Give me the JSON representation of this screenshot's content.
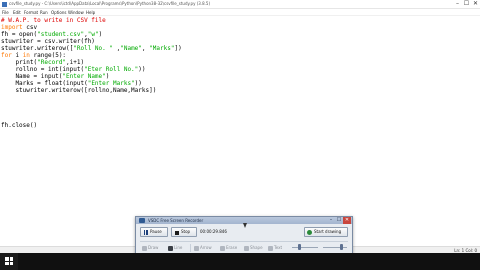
{
  "window": {
    "title": "csvfile_study.py - C:\\Users\\ictd\\AppData\\Local\\Programs\\Python\\Python38-32\\csvfile_study.py (3.8.5)",
    "controls": {
      "minimize": "–",
      "maximize": "☐",
      "close": "✕"
    }
  },
  "menu": [
    "File",
    "Edit",
    "Format",
    "Run",
    "Options",
    "Window",
    "Help"
  ],
  "code": [
    [
      {
        "t": "# W.A.P. to write in CSV file",
        "c": "c-comment"
      }
    ],
    [
      {
        "t": "import",
        "c": "c-kw"
      },
      {
        "t": " csv",
        "c": "c-plain"
      }
    ],
    [
      {
        "t": "fh = open(",
        "c": "c-plain"
      },
      {
        "t": "\"student.csv\"",
        "c": "c-str"
      },
      {
        "t": ",",
        "c": "c-plain"
      },
      {
        "t": "\"w\"",
        "c": "c-str"
      },
      {
        "t": ")",
        "c": "c-plain"
      }
    ],
    [
      {
        "t": "stuwriter = csv.writer(fh)",
        "c": "c-plain"
      }
    ],
    [
      {
        "t": "stuwriter.writerow([",
        "c": "c-plain"
      },
      {
        "t": "\"Roll No. \"",
        "c": "c-str"
      },
      {
        "t": " ,",
        "c": "c-plain"
      },
      {
        "t": "\"Name\"",
        "c": "c-str"
      },
      {
        "t": ", ",
        "c": "c-plain"
      },
      {
        "t": "\"Marks\"",
        "c": "c-str"
      },
      {
        "t": "])",
        "c": "c-plain"
      }
    ],
    [
      {
        "t": "for",
        "c": "c-kw"
      },
      {
        "t": " i ",
        "c": "c-plain"
      },
      {
        "t": "in",
        "c": "c-kw"
      },
      {
        "t": " range(5):",
        "c": "c-plain"
      }
    ],
    [
      {
        "t": "    print(",
        "c": "c-plain"
      },
      {
        "t": "\"Record\"",
        "c": "c-str"
      },
      {
        "t": ",i+1)",
        "c": "c-plain"
      }
    ],
    [
      {
        "t": "    rollno = int(input(",
        "c": "c-plain"
      },
      {
        "t": "\"Eter Roll No.\"",
        "c": "c-str"
      },
      {
        "t": "))",
        "c": "c-plain"
      }
    ],
    [
      {
        "t": "    Name = input(",
        "c": "c-plain"
      },
      {
        "t": "\"Enter Name\"",
        "c": "c-str"
      },
      {
        "t": ")",
        "c": "c-plain"
      }
    ],
    [
      {
        "t": "    Marks = float(input(",
        "c": "c-plain"
      },
      {
        "t": "\"Enter Marks\"",
        "c": "c-str"
      },
      {
        "t": "))",
        "c": "c-plain"
      }
    ],
    [
      {
        "t": "    stuwriter.writerow([rollno,Name,Marks])",
        "c": "c-plain"
      }
    ],
    [],
    [],
    [],
    [],
    [
      {
        "t": "fh.close()",
        "c": "c-plain"
      }
    ]
  ],
  "status": {
    "position": "Ln: 1   Col: 0"
  },
  "recorder": {
    "title": "VSDC Free Screen Recorder",
    "pause_label": "Pause",
    "stop_label": "Stop",
    "timer": "00:00:29.846",
    "start_show_label": "Start drawing",
    "tools": [
      "Draw",
      "Line",
      "Arrow",
      "Erase",
      "Shape",
      "Text"
    ],
    "close": "✕",
    "minimize": "–",
    "expand": "☐"
  },
  "colors": {
    "comment": "#dd0000",
    "keyword": "#ff7700",
    "string": "#00aa00",
    "taskbar": "#101010",
    "recorder_bg": "#e8ecf1"
  }
}
